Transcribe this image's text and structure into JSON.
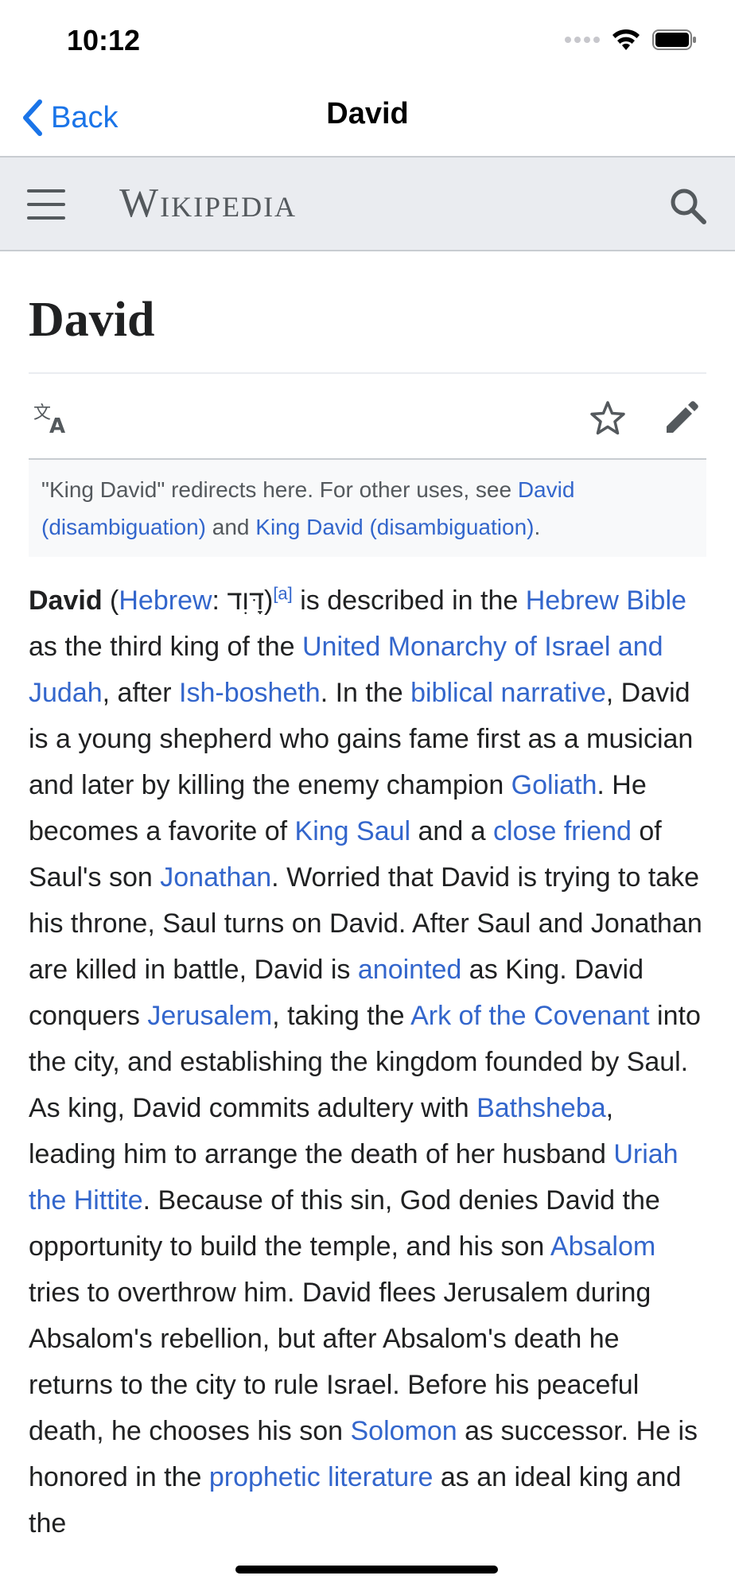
{
  "status_bar": {
    "time": "10:12"
  },
  "nav": {
    "back_label": "Back",
    "title": "David"
  },
  "header": {
    "wordmark": "Wikipedia"
  },
  "article": {
    "title": "David",
    "hatnote": {
      "before": "\"King David\" redirects here. For other uses, see ",
      "link1": "David (disambiguation)",
      "middle": " and ",
      "link2": "King David (disambiguation)",
      "end": "."
    },
    "paragraph": [
      {
        "t": "bold",
        "v": "David"
      },
      {
        "t": "text",
        "v": " ("
      },
      {
        "t": "link",
        "v": "Hebrew"
      },
      {
        "t": "text",
        "v": ": דָּוִד)"
      },
      {
        "t": "sup",
        "v": "[a]"
      },
      {
        "t": "text",
        "v": " is described in the "
      },
      {
        "t": "link",
        "v": "Hebrew Bible"
      },
      {
        "t": "text",
        "v": " as the third king of the "
      },
      {
        "t": "link",
        "v": "United Monarchy of Israel and Judah"
      },
      {
        "t": "text",
        "v": ", after "
      },
      {
        "t": "link",
        "v": "Ish-bosheth"
      },
      {
        "t": "text",
        "v": ". In the "
      },
      {
        "t": "link",
        "v": "biblical narrative"
      },
      {
        "t": "text",
        "v": ", David is a young shepherd who gains fame first as a musician and later by killing the enemy champion "
      },
      {
        "t": "link",
        "v": "Goliath"
      },
      {
        "t": "text",
        "v": ". He becomes a favorite of "
      },
      {
        "t": "link",
        "v": "King Saul"
      },
      {
        "t": "text",
        "v": " and a "
      },
      {
        "t": "link",
        "v": "close friend"
      },
      {
        "t": "text",
        "v": " of Saul's son "
      },
      {
        "t": "link",
        "v": "Jonathan"
      },
      {
        "t": "text",
        "v": ". Worried that David is trying to take his throne, Saul turns on David. After Saul and Jonathan are killed in battle, David is "
      },
      {
        "t": "link",
        "v": "anointed"
      },
      {
        "t": "text",
        "v": " as King. David conquers "
      },
      {
        "t": "link",
        "v": "Jerusalem"
      },
      {
        "t": "text",
        "v": ", taking the "
      },
      {
        "t": "link",
        "v": "Ark of the Covenant"
      },
      {
        "t": "text",
        "v": " into the city, and establishing the kingdom founded by Saul. As king, David commits adultery with "
      },
      {
        "t": "link",
        "v": "Bathsheba"
      },
      {
        "t": "text",
        "v": ", leading him to arrange the death of her husband "
      },
      {
        "t": "link",
        "v": "Uriah the Hittite"
      },
      {
        "t": "text",
        "v": ". Because of this sin, God denies David the opportunity to build the temple, and his son "
      },
      {
        "t": "link",
        "v": "Absalom"
      },
      {
        "t": "text",
        "v": " tries to overthrow him. David flees Jerusalem during Absalom's rebellion, but after Absalom's death he returns to the city to rule Israel. Before his peaceful death, he chooses his son "
      },
      {
        "t": "link",
        "v": "Solomon"
      },
      {
        "t": "text",
        "v": " as successor. He is honored in the "
      },
      {
        "t": "link",
        "v": "prophetic literature"
      },
      {
        "t": "text",
        "v": " as an ideal king and the"
      }
    ]
  },
  "icons": {
    "back": "chevron-left-icon",
    "menu": "hamburger-menu-icon",
    "search": "search-icon",
    "language": "language-icon",
    "watch": "star-icon",
    "edit": "pencil-icon"
  },
  "colors": {
    "ios_blue": "#1a74e8",
    "wiki_link": "#3366cc",
    "header_bg": "#eaecf0",
    "text": "#202122",
    "muted": "#54595d"
  }
}
